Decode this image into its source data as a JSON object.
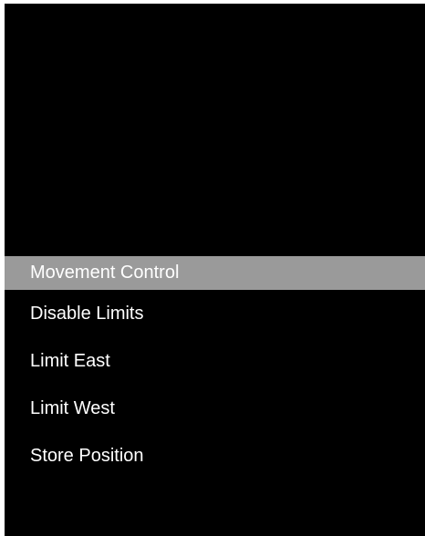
{
  "menu": {
    "items": [
      {
        "label": "Movement Control",
        "selected": true
      },
      {
        "label": "Disable Limits",
        "selected": false
      },
      {
        "label": "Limit East",
        "selected": false
      },
      {
        "label": "Limit West",
        "selected": false
      },
      {
        "label": "Store Position",
        "selected": false
      }
    ]
  },
  "colors": {
    "background": "#000000",
    "highlight": "#9a9a9a",
    "text": "#ffffff"
  }
}
